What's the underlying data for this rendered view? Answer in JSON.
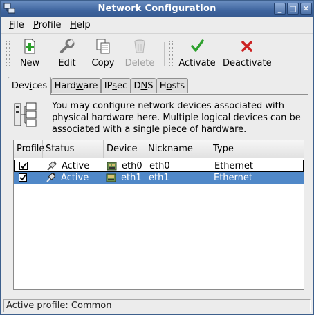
{
  "window": {
    "title": "Network Configuration",
    "controls": {
      "minimize": "_",
      "maximize": "□",
      "close": "✕"
    }
  },
  "menubar": {
    "items": [
      {
        "prefix": "",
        "mnemonic": "F",
        "suffix": "ile"
      },
      {
        "prefix": "",
        "mnemonic": "P",
        "suffix": "rofile"
      },
      {
        "prefix": "",
        "mnemonic": "H",
        "suffix": "elp"
      }
    ]
  },
  "toolbar": {
    "new_label": "New",
    "edit_label": "Edit",
    "copy_label": "Copy",
    "delete_label": "Delete",
    "activate_label": "Activate",
    "deactivate_label": "Deactivate",
    "delete_disabled": true
  },
  "tabs": [
    {
      "prefix": "Dev",
      "mnemonic": "i",
      "suffix": "ces",
      "active": true
    },
    {
      "prefix": "Hard",
      "mnemonic": "w",
      "suffix": "are",
      "active": false
    },
    {
      "prefix": "IP",
      "mnemonic": "s",
      "suffix": "ec",
      "active": false
    },
    {
      "prefix": "D",
      "mnemonic": "N",
      "suffix": "S",
      "active": false
    },
    {
      "prefix": "H",
      "mnemonic": "o",
      "suffix": "sts",
      "active": false
    }
  ],
  "devices_tab": {
    "description": "You may configure network devices associated with physical hardware here.  Multiple logical devices can be associated with a single piece of hardware.",
    "columns": [
      "Profile",
      "Status",
      "Device",
      "Nickname",
      "Type"
    ],
    "rows": [
      {
        "profile_checked": true,
        "status": "Active",
        "device": "eth0",
        "nickname": "eth0",
        "type": "Ethernet",
        "selected": false,
        "focused": true
      },
      {
        "profile_checked": true,
        "status": "Active",
        "device": "eth1",
        "nickname": "eth1",
        "type": "Ethernet",
        "selected": true,
        "focused": false
      }
    ]
  },
  "statusbar": {
    "text": "Active profile: Common"
  },
  "colors": {
    "titlebar": "#3e649e",
    "selection": "#5088c8",
    "activate_icon": "#2ea12e",
    "deactivate_icon": "#cc2222"
  },
  "icons": {
    "new": "new-document-icon",
    "edit": "wrench-icon",
    "copy": "copy-icon",
    "delete": "trash-icon",
    "activate": "checkmark-icon",
    "deactivate": "x-mark-icon",
    "status": "plug-icon",
    "device": "network-card-icon",
    "info": "network-devices-icon"
  }
}
